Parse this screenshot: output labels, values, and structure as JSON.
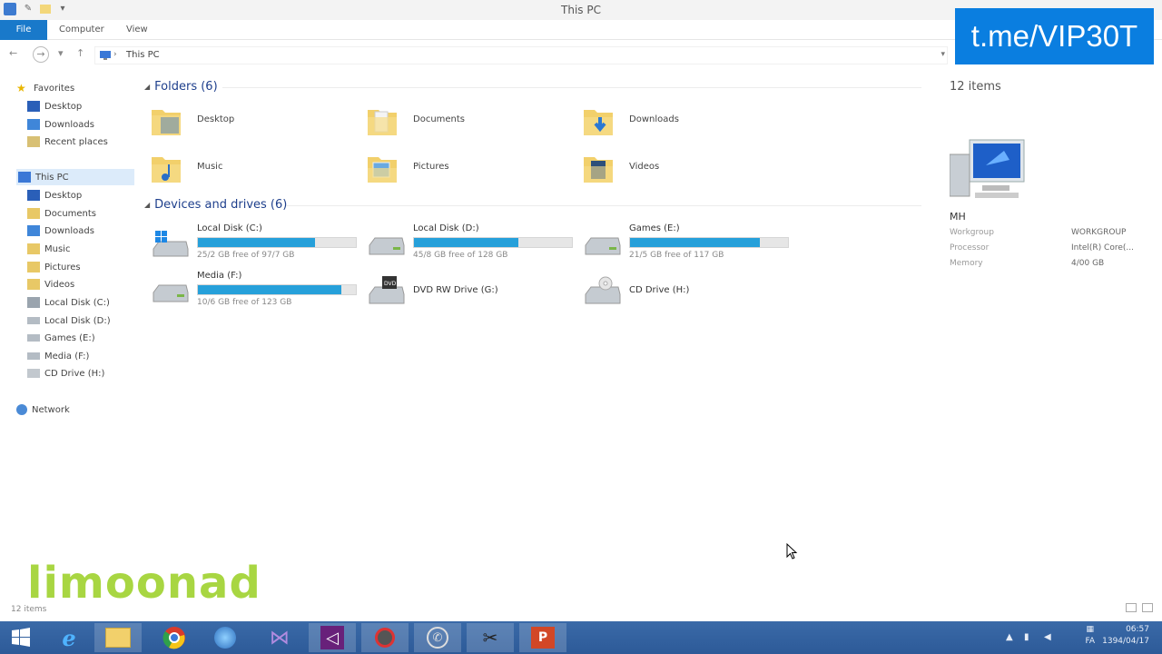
{
  "window": {
    "title": "This PC"
  },
  "ribbon": {
    "tabs": [
      "File",
      "Computer",
      "View"
    ]
  },
  "address": {
    "path": "This PC"
  },
  "sidebar": {
    "favorites_label": "Favorites",
    "favorites": [
      "Desktop",
      "Downloads",
      "Recent places"
    ],
    "thispc_label": "This PC",
    "thispc_items": [
      "Desktop",
      "Documents",
      "Downloads",
      "Music",
      "Pictures",
      "Videos",
      "Local Disk (C:)",
      "Local Disk (D:)",
      "Games (E:)",
      "Media (F:)",
      "CD Drive (H:)"
    ],
    "network_label": "Network"
  },
  "folders": {
    "header": "Folders (6)",
    "items": [
      "Desktop",
      "Documents",
      "Downloads",
      "Music",
      "Pictures",
      "Videos"
    ]
  },
  "drives": {
    "header": "Devices and drives (6)",
    "items": [
      {
        "name": "Local Disk (C:)",
        "free": "25/2 GB free of 97/7 GB",
        "used_fraction": 0.74
      },
      {
        "name": "Local Disk (D:)",
        "free": "45/8 GB free of 128 GB",
        "used_fraction": 0.66
      },
      {
        "name": "Games (E:)",
        "free": "21/5 GB free of 117 GB",
        "used_fraction": 0.82
      },
      {
        "name": "Media (F:)",
        "free": "10/6 GB free of 123 GB",
        "used_fraction": 0.91
      },
      {
        "name": "DVD RW Drive (G:)"
      },
      {
        "name": "CD Drive (H:)"
      }
    ]
  },
  "details": {
    "count": "12 items",
    "pc_name": "MH",
    "rows": [
      {
        "key": "Workgroup",
        "value": "WORKGROUP"
      },
      {
        "key": "Processor",
        "value": "Intel(R) Core(..."
      },
      {
        "key": "Memory",
        "value": "4/00 GB"
      }
    ]
  },
  "status": {
    "count": "12 items"
  },
  "watermarks": {
    "telegram": "t.me/VIP30T",
    "brand": "limoonad"
  },
  "tray": {
    "lang": "FA",
    "time": "06:57",
    "date": "1394/04/17"
  },
  "colors": {
    "accent": "#1979ca",
    "bar_fill": "#26a0da",
    "taskbar": "#2d5a98",
    "brand_green": "#a8d642"
  }
}
